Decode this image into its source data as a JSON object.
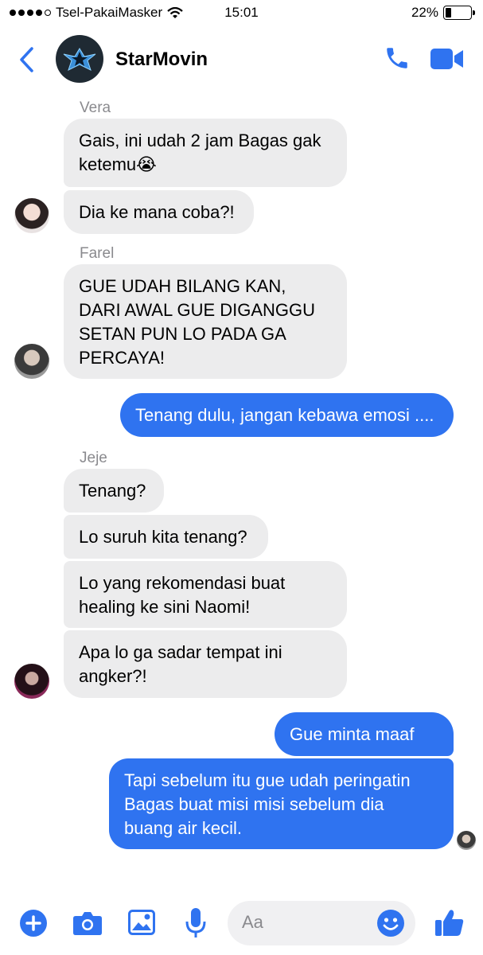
{
  "status_bar": {
    "carrier": "Tsel-PakaiMasker",
    "time": "15:01",
    "battery": "22%",
    "battery_level": 0.22
  },
  "header": {
    "group_name": "StarMovin",
    "back_icon": "chevron-left-icon",
    "call_icon": "phone-icon",
    "video_icon": "video-camera-icon"
  },
  "colors": {
    "accent": "#2f73f0",
    "incoming_bubble": "#ececed",
    "sender_name": "#8a8a8e"
  },
  "messages": {
    "vera": {
      "name": "Vera",
      "m1": "Gais, ini udah 2 jam Bagas gak\nketemu😭",
      "m2": "Dia ke mana coba?!"
    },
    "farel": {
      "name": "Farel",
      "m1": "GUE UDAH BILANG KAN,\nDARI AWAL GUE DIGANGGU\nSETAN PUN LO PADA GA\nPERCAYA!"
    },
    "me1": "Tenang dulu, jangan kebawa emosi ....",
    "jeje": {
      "name": "Jeje",
      "m1": "Tenang?",
      "m2": "Lo suruh kita tenang?",
      "m3": "Lo yang rekomendasi buat\nhealing ke sini Naomi!",
      "m4": "Apa lo ga sadar tempat ini\nangker?!"
    },
    "me2": "Gue minta maaf ....",
    "me3": "Tapi sebelum itu gue udah peringatin\nBagas buat misi misi sebelum dia\nbuang air kecil."
  },
  "composer": {
    "placeholder": "Aa",
    "icons": [
      "plus-icon",
      "camera-icon",
      "image-icon",
      "microphone-icon",
      "emoji-icon",
      "thumbs-up-icon"
    ]
  }
}
